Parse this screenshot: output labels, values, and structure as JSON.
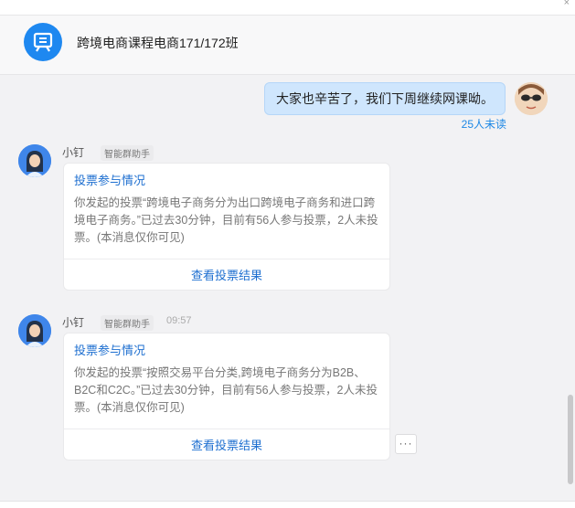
{
  "header": {
    "title": "跨境电商课程电商171/172班"
  },
  "outgoing": {
    "text": "大家也辛苦了，我们下周继续网课呦。",
    "unread": "25人未读"
  },
  "messages": [
    {
      "sender": "小钉",
      "tag": "智能群助手",
      "time": "",
      "card_title": "投票参与情况",
      "card_body": "你发起的投票“跨境电子商务分为出口跨境电子商务和进口跨境电子商务。”已过去30分钟，目前有56人参与投票，2人未投票。(本消息仅你可见)",
      "card_link": "查看投票结果"
    },
    {
      "sender": "小钉",
      "tag": "智能群助手",
      "time": "09:57",
      "card_title": "投票参与情况",
      "card_body": "你发起的投票“按照交易平台分类,跨境电子商务分为B2B、B2C和C2C。”已过去30分钟，目前有56人参与投票，2人未投票。(本消息仅你可见)",
      "card_link": "查看投票结果"
    }
  ],
  "more_button": "···",
  "colors": {
    "accent": "#1e88f0",
    "link": "#1e6fd0",
    "self_bubble": "#cfe6fd"
  }
}
